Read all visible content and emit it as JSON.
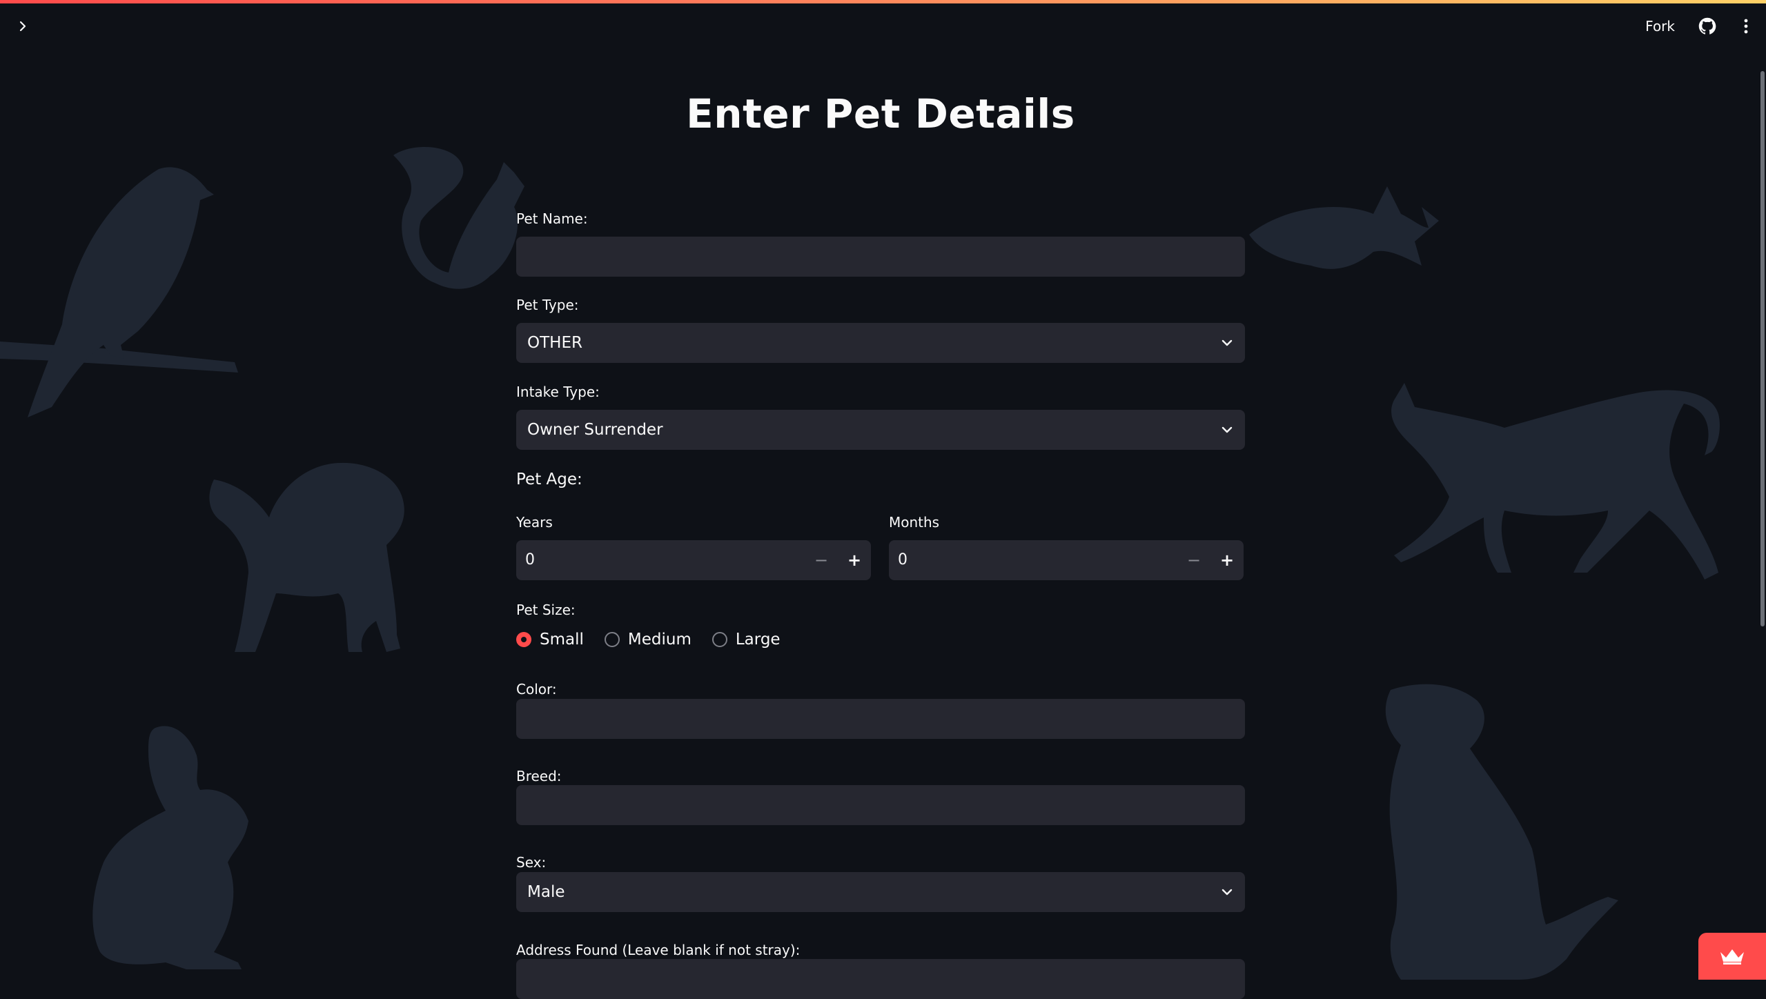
{
  "app": {
    "title": "Enter Pet Details",
    "accent_color": "#ff4b4b",
    "background_color": "#0e1117",
    "input_background_color": "#262730"
  },
  "toolbar": {
    "sidebar_toggle_icon": "chevron-right-icon",
    "fork_label": "Fork",
    "github_icon": "github-icon",
    "menu_icon": "kebab-menu-icon"
  },
  "form": {
    "pet_name": {
      "label": "Pet Name:",
      "value": ""
    },
    "pet_type": {
      "label": "Pet Type:",
      "value": "OTHER"
    },
    "intake_type": {
      "label": "Intake Type:",
      "value": "Owner Surrender"
    },
    "pet_age": {
      "heading": "Pet Age:",
      "years": {
        "label": "Years",
        "value": "0"
      },
      "months": {
        "label": "Months",
        "value": "0"
      },
      "minus_symbol": "−",
      "plus_symbol": "+"
    },
    "pet_size": {
      "label": "Pet Size:",
      "options": [
        "Small",
        "Medium",
        "Large"
      ],
      "selected": "Small"
    },
    "color": {
      "label": "Color:",
      "value": ""
    },
    "breed": {
      "label": "Breed:",
      "value": ""
    },
    "sex": {
      "label": "Sex:",
      "value": "Male"
    },
    "address_found": {
      "label": "Address Found (Leave blank if not stray):",
      "value": ""
    }
  },
  "background_art": [
    "bird-silhouette",
    "squirrel-silhouette",
    "fish-silhouette",
    "cat-silhouette",
    "puppy-silhouette",
    "rabbit-silhouette",
    "dog-silhouette"
  ],
  "badge": {
    "icon": "crown-icon"
  }
}
